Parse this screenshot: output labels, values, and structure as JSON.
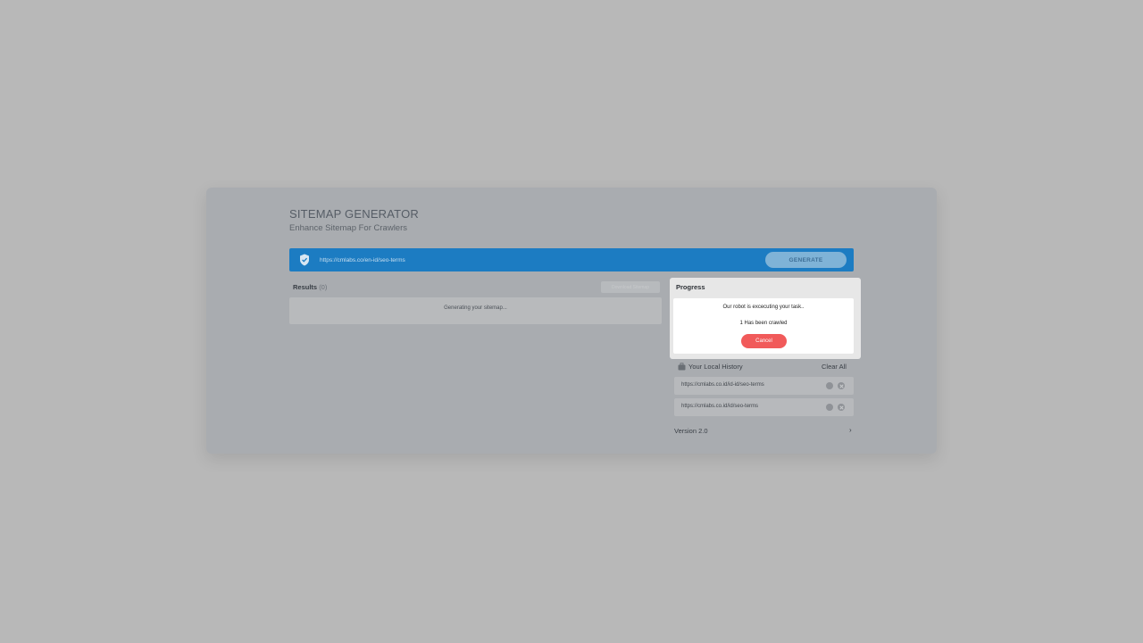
{
  "header": {
    "title": "SITEMAP GENERATOR",
    "subtitle": "Enhance Sitemap For Crawlers"
  },
  "url_bar": {
    "value": "https://cmlabs.co/en-id/seo-terms",
    "generate_label": "GENERATE",
    "icon": "shield-check-icon",
    "accent_color": "#1c7cc2"
  },
  "results": {
    "label": "Results",
    "count": "(0)",
    "download_label": "Download Sitemap",
    "status_text": "Generating your sitemap..."
  },
  "progress": {
    "title": "Progress",
    "message": "Our robot is excecuting your task..",
    "crawled": "1 Has been crawled",
    "cancel_label": "Cancel",
    "cancel_color": "#f15a5a"
  },
  "history": {
    "title": "Your Local History",
    "clear_label": "Clear All",
    "icon": "briefcase-icon",
    "items": [
      {
        "url": "https://cmlabs.co.id/id-id/seo-terms"
      },
      {
        "url": "https://cmlabs.co.id/id/seo-terms"
      }
    ]
  },
  "footer": {
    "version": "Version 2.0",
    "chevron": "›"
  }
}
